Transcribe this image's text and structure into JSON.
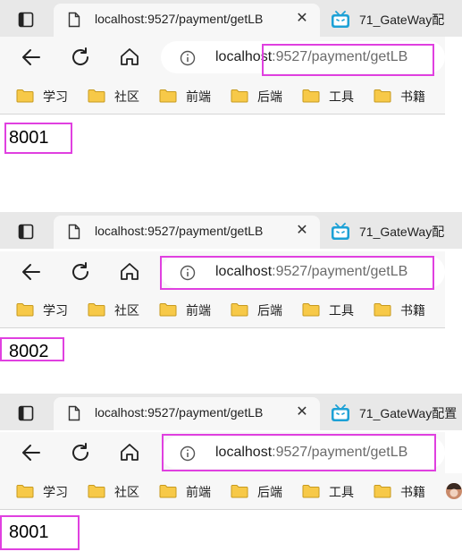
{
  "colors": {
    "highlight": "#e040e0",
    "tabstrip": "#e8e8e8",
    "toolbar": "#f7f7f7"
  },
  "captures": [
    {
      "active_tab_title": "localhost:9527/payment/getLB",
      "inactive_tab_title": "71_GateWay配",
      "url_host": "localhost",
      "url_path": ":9527/payment/getLB",
      "bookmarks": [
        "学习",
        "社区",
        "前端",
        "后端",
        "工具",
        "书籍"
      ],
      "response": "8001"
    },
    {
      "active_tab_title": "localhost:9527/payment/getLB",
      "inactive_tab_title": "71_GateWay配",
      "url_host": "localhost",
      "url_path": ":9527/payment/getLB",
      "bookmarks": [
        "学习",
        "社区",
        "前端",
        "后端",
        "工具",
        "书籍"
      ],
      "response": "8002"
    },
    {
      "active_tab_title": "localhost:9527/payment/getLB",
      "inactive_tab_title": "71_GateWay配置",
      "url_host": "localhost",
      "url_path": ":9527/payment/getLB",
      "bookmarks": [
        "学习",
        "社区",
        "前端",
        "后端",
        "工具",
        "书籍"
      ],
      "response": "8001"
    }
  ]
}
